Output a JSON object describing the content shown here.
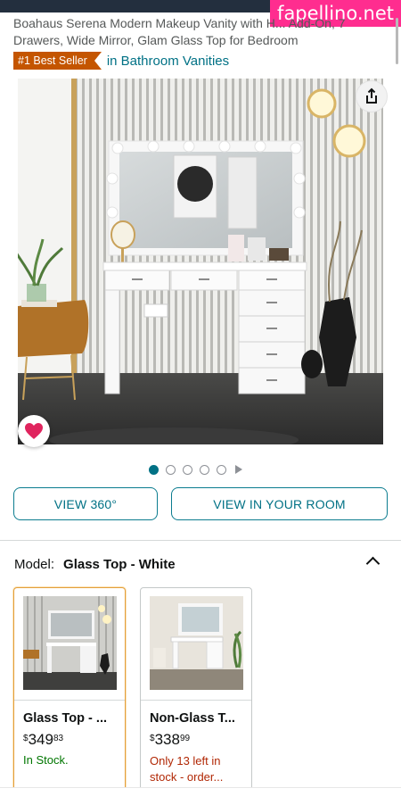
{
  "watermark": "fapellino.net",
  "product": {
    "title": "Boahaus Serena Modern Makeup Vanity with H... Add-On, 7 Drawers, Wide Mirror, Glam Glass Top for Bedroom",
    "badge": "#1 Best Seller",
    "badge_category": "in Bathroom Vanities"
  },
  "gallery": {
    "dot_count": 5,
    "active_index": 0
  },
  "actions": {
    "view_360": "VIEW 360°",
    "view_room": "VIEW IN YOUR ROOM"
  },
  "model": {
    "label": "Model:",
    "value": "Glass Top - White"
  },
  "variants": [
    {
      "name": "Glass Top - ...",
      "currency": "$",
      "price_whole": "349",
      "price_fraction": "83",
      "stock": "In Stock.",
      "selected": true
    },
    {
      "name": "Non-Glass T...",
      "currency": "$",
      "price_whole": "338",
      "price_fraction": "99",
      "stock": "Only 13 left in stock - order...",
      "selected": false
    }
  ],
  "colors": {
    "accent_link": "#007185",
    "badge": "#c45500",
    "in_stock": "#007600",
    "low_stock": "#b12704",
    "selected_border": "#e39f3c",
    "wishlist_heart": "#e0245e"
  }
}
